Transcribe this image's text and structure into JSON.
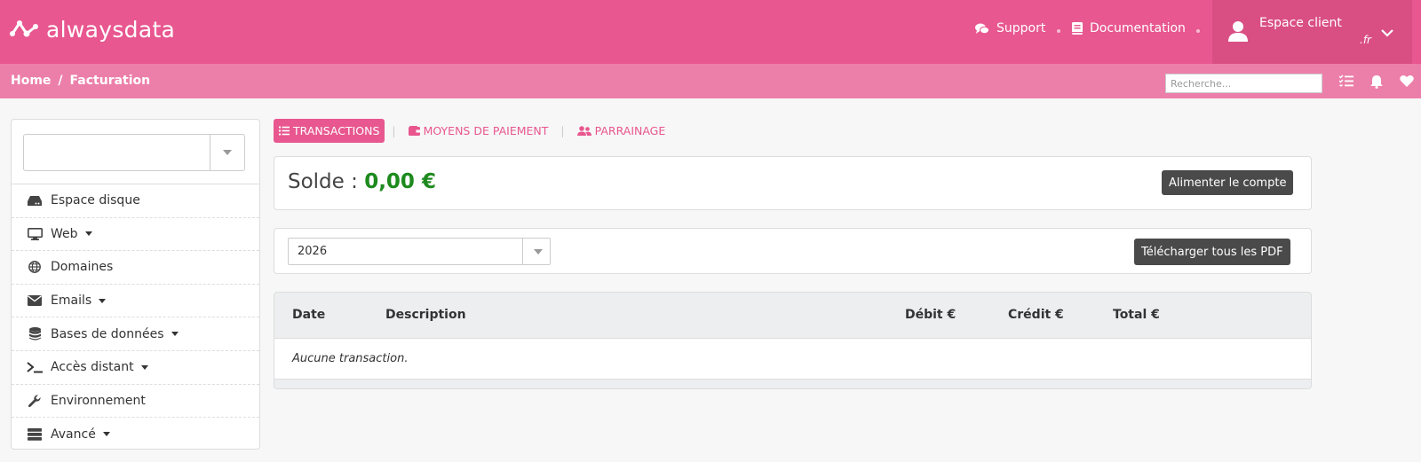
{
  "header": {
    "logo_text": "alwaysdata",
    "nav": [
      {
        "label": "Support",
        "icon": "comments-icon"
      },
      {
        "label": "Documentation",
        "icon": "book-icon"
      }
    ],
    "account": {
      "label": "Espace client",
      "sub": ".fr",
      "icon": "user-icon"
    }
  },
  "breadcrumb": {
    "home": "Home",
    "separator": "/",
    "current": "Facturation"
  },
  "search": {
    "placeholder": "Recherche..."
  },
  "sidebar": {
    "select_value": "",
    "items": [
      {
        "label": "Espace disque",
        "icon": "hdd-icon",
        "dropdown": false
      },
      {
        "label": "Web",
        "icon": "desktop-icon",
        "dropdown": true
      },
      {
        "label": "Domaines",
        "icon": "globe-icon",
        "dropdown": false
      },
      {
        "label": "Emails",
        "icon": "envelope-icon",
        "dropdown": true
      },
      {
        "label": "Bases de données",
        "icon": "database-icon",
        "dropdown": true
      },
      {
        "label": "Accès distant",
        "icon": "terminal-icon",
        "dropdown": true
      },
      {
        "label": "Environnement",
        "icon": "wrench-icon",
        "dropdown": false
      },
      {
        "label": "Avancé",
        "icon": "server-icon",
        "dropdown": true
      }
    ]
  },
  "tabs": [
    {
      "label": "TRANSACTIONS",
      "icon": "list-icon",
      "active": true
    },
    {
      "label": "MOYENS DE PAIEMENT",
      "icon": "wallet-icon",
      "active": false
    },
    {
      "label": "PARRAINAGE",
      "icon": "users-icon",
      "active": false
    }
  ],
  "balance": {
    "label": "Solde :",
    "amount": "0,00 €",
    "button": "Alimenter le compte"
  },
  "year": {
    "value": "2026",
    "button": "Télécharger tous les PDF"
  },
  "table": {
    "columns": [
      "Date",
      "Description",
      "Débit €",
      "Crédit €",
      "Total €"
    ],
    "empty_message": "Aucune transaction."
  },
  "colors": {
    "brand": "#e8578f",
    "brand_light": "#ec7fa9",
    "positive": "#1d8a1d"
  }
}
